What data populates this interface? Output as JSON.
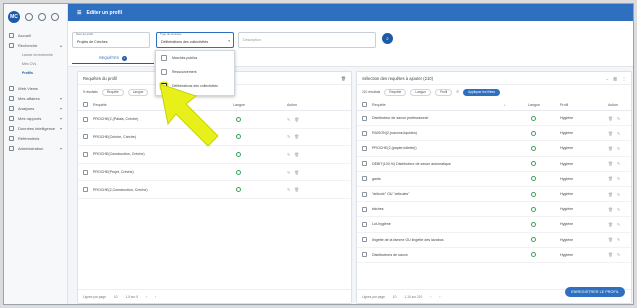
{
  "sidebar": {
    "avatar": "MC",
    "items": [
      {
        "label": "Accueil",
        "icon": "home-icon"
      },
      {
        "label": "Recherche",
        "icon": "search-icon",
        "chevron": "▴"
      }
    ],
    "subitems": [
      {
        "label": "Lancer la recherche",
        "active": false
      },
      {
        "label": "Mes CVs",
        "active": false
      },
      {
        "label": "Profils",
        "active": true
      }
    ],
    "items2": [
      {
        "label": "Web Views",
        "icon": "web-icon"
      },
      {
        "label": "Mes affaires",
        "icon": "briefcase-icon",
        "chevron": "▾"
      },
      {
        "label": "Analyses",
        "icon": "chart-icon",
        "chevron": "▾"
      },
      {
        "label": "Mes rapports",
        "icon": "report-icon",
        "chevron": "▾"
      },
      {
        "label": "Données intelligence",
        "icon": "data-icon",
        "chevron": "▾"
      },
      {
        "label": "Référentiels",
        "icon": "book-icon"
      },
      {
        "label": "Administration",
        "icon": "admin-icon",
        "chevron": "▾"
      }
    ]
  },
  "topbar": {
    "title": "Editer un profil"
  },
  "filters": {
    "profile": {
      "label": "Nom du profil",
      "value": "Projets de Crèches"
    },
    "type": {
      "label": "Type de données",
      "value": "Délibérations des collectivités"
    },
    "description": {
      "placeholder": "Description"
    },
    "tab": {
      "label": "REQUÊTES",
      "badge": "1"
    }
  },
  "dropdown": {
    "options": [
      {
        "label": "Marchés publics",
        "checked": false
      },
      {
        "label": "Ressourcement",
        "checked": false
      },
      {
        "label": "Délibérations des collectivités",
        "checked": false
      }
    ]
  },
  "left_panel": {
    "title": "Requêtes du profil",
    "count": "5 résultats",
    "chips": [
      "Requête",
      "Langue"
    ],
    "columns": {
      "query": "Requête",
      "lang": "Langue",
      "action": "Action"
    },
    "rows": [
      "PROCHE(2,(Palais, Crèche)",
      "PROCHE(Crèche, Crèche)",
      "PROCHE(Construction, Crèche)",
      "PROCHE(Projet, Crèche)",
      "PROCHE(2,Construction, Crèche)"
    ],
    "footer": {
      "per_page_label": "Lignes par page",
      "per_page": "10",
      "range": "1-5 sur 5"
    }
  },
  "right_panel": {
    "title": "Sélection des requêtes à ajouter (210)",
    "count": "210 résultats",
    "chips": [
      "Requête",
      "Langue",
      "Profil"
    ],
    "apply_label": "Appliquer les filtres",
    "columns": {
      "query": "Requête",
      "lang": "Langue",
      "profile": "Profil",
      "action": "Action"
    },
    "rows": [
      {
        "query": "Distributeur de savon professionnel",
        "profile": "Hygiène"
      },
      {
        "query": "RAISON(2,(savons,liquides)",
        "profile": "Hygiène"
      },
      {
        "query": "PROCHE(2,(papier,toilette))",
        "profile": "Hygiène"
      },
      {
        "query": "DÉBIT(100,%) Distributeur de savon automatique",
        "profile": "Hygiène"
      },
      {
        "query": "gants",
        "profile": "Hygiène"
      },
      {
        "query": "\"articule\" OU \"articules\"",
        "profile": "Hygiène"
      },
      {
        "query": "bâches",
        "profile": "Hygiène"
      },
      {
        "query": "Lot-hygiène",
        "profile": "Hygiène"
      },
      {
        "query": "lingette de la famme OU lingette des lavabos",
        "profile": "Hygiène"
      },
      {
        "query": "Distributeurs de savon",
        "profile": "Hygiène"
      }
    ],
    "footer": {
      "per_page_label": "Lignes par page",
      "per_page": "10",
      "range": "1-10 sur 210"
    }
  },
  "save_button": "ENREGISTRER LE PROFIL",
  "colors": {
    "primary": "#2f6fc0",
    "arrow": "#e8f01a",
    "ok": "#3aa55a"
  }
}
